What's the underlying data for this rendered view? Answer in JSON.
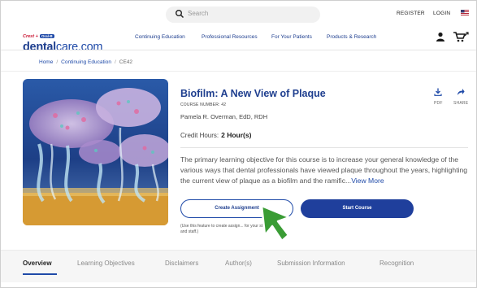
{
  "header": {
    "search_placeholder": "Search",
    "register": "REGISTER",
    "login": "LOGIN",
    "locale_icon": "us-flag-icon"
  },
  "logo": {
    "crest": "Crest +",
    "oralb": "Oral-B",
    "brand_bold": "dental",
    "brand_rest": "care.com"
  },
  "nav": {
    "items": [
      "Continuing Education",
      "Professional Resources",
      "For Your Patients",
      "Products & Research"
    ]
  },
  "breadcrumb": {
    "home": "Home",
    "section": "Continuing Education",
    "current": "CE42"
  },
  "course": {
    "title": "Biofilm: A New View of Plaque",
    "number": "COURSE NUMBER: 42",
    "author": "Pamela R. Overman, EdD, RDH",
    "credit_label": "Credit Hours:",
    "credit_value": "2 Hour(s)",
    "description": "The primary learning objective for this course is to increase your general knowledge of the various ways that dental professionals have viewed plaque throughout the years, highlighting the current view of plaque as a biofilm and the ramific...",
    "view_more": "View More",
    "pdf_label": "PDF",
    "share_label": "SHARE"
  },
  "actions": {
    "create": "Create Assignment",
    "start": "Start Course",
    "helper": "(Use this feature to create assign... for your students and staff.)"
  },
  "tabs": [
    "Overview",
    "Learning Objectives",
    "Disclaimers",
    "Author(s)",
    "Submission Information",
    "Recognition"
  ],
  "colors": {
    "brand_blue": "#1f4aa8",
    "button_blue": "#1f3f9c",
    "cursor_green": "#3a9c35"
  }
}
